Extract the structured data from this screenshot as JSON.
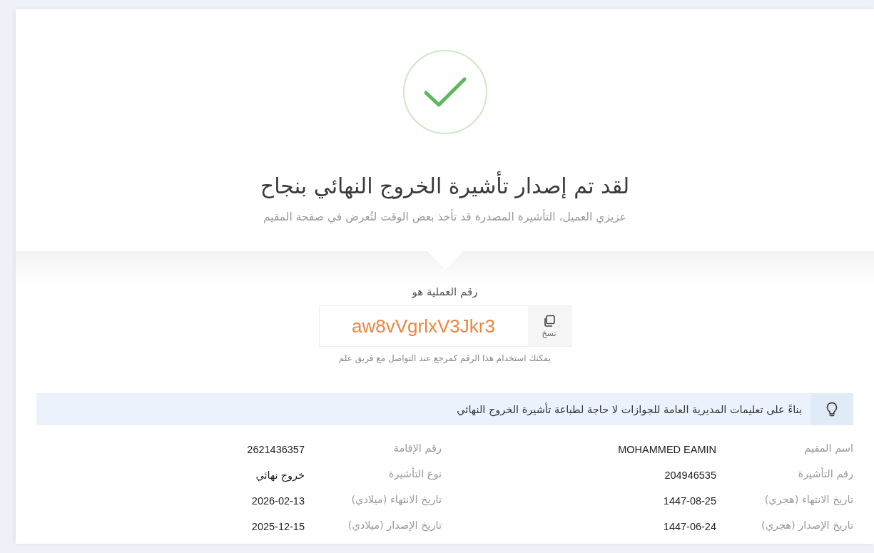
{
  "success": {
    "title": "لقد تم إصدار تأشيرة الخروج النهائي بنجاح",
    "subtitle": "عزيزي العميل، التأشيرة المصدرة قد تأخذ بعض الوقت لتُعرض في صفحة المقيم"
  },
  "transaction": {
    "label": "رقم العملية هو",
    "code": "aw8vVgrlxV3Jkr3",
    "copy_label": "نسخ",
    "hint": "يمكنك استخدام هذا الرقم كمرجع عند التواصل مع فريق علم"
  },
  "notice": "بناءً على تعليمات المديرية العامة للجوازات لا حاجة لطباعة تأشيرة الخروج النهائي",
  "details": [
    {
      "label": "اسم المقيم",
      "value": "MOHAMMED EAMIN"
    },
    {
      "label": "رقم الإقامة",
      "value": "2621436357"
    },
    {
      "label": "رقم التأشيرة",
      "value": "204946535"
    },
    {
      "label": "نوع التأشيرة",
      "value": "خروج نهائي"
    },
    {
      "label": "تاريخ الانتهاء (هجري)",
      "value": "1447-08-25"
    },
    {
      "label": "تاريخ الانتهاء (ميلادي)",
      "value": "2026-02-13"
    },
    {
      "label": "تاريخ الإصدار (هجري)",
      "value": "1447-06-24"
    },
    {
      "label": "تاريخ الإصدار (ميلادي)",
      "value": "2025-12-15"
    }
  ]
}
